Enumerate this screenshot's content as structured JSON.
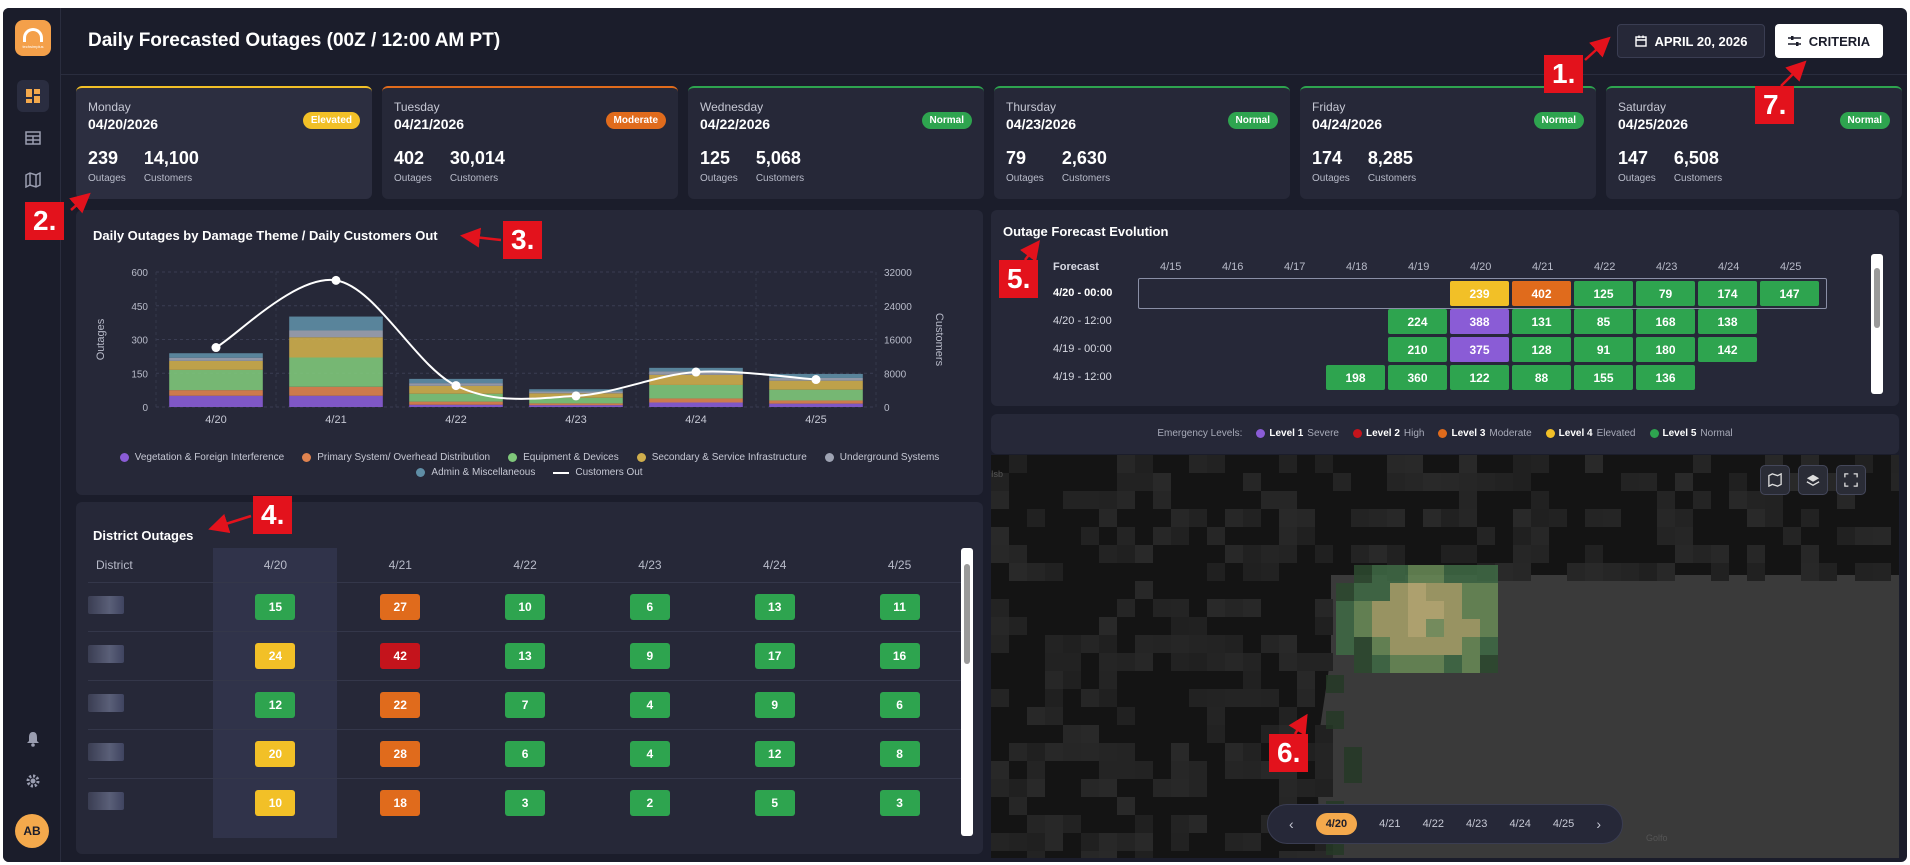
{
  "header": {
    "title": "Daily Forecasted Outages (00Z / 12:00 AM PT)",
    "date_label": "APRIL 20, 2026",
    "criteria_label": "CRITERIA"
  },
  "logo": {
    "text": "techsimplus"
  },
  "user": {
    "initials": "AB"
  },
  "days": [
    {
      "name": "Monday",
      "date": "04/20/2026",
      "status": "Elevated",
      "color": "#f2c027",
      "outages": "239",
      "customers": "14,100"
    },
    {
      "name": "Tuesday",
      "date": "04/21/2026",
      "status": "Moderate",
      "color": "#e06b1c",
      "outages": "402",
      "customers": "30,014"
    },
    {
      "name": "Wednesday",
      "date": "04/22/2026",
      "status": "Normal",
      "color": "#2ea44f",
      "outages": "125",
      "customers": "5,068"
    },
    {
      "name": "Thursday",
      "date": "04/23/2026",
      "status": "Normal",
      "color": "#2ea44f",
      "outages": "79",
      "customers": "2,630"
    },
    {
      "name": "Friday",
      "date": "04/24/2026",
      "status": "Normal",
      "color": "#2ea44f",
      "outages": "174",
      "customers": "8,285"
    },
    {
      "name": "Saturday",
      "date": "04/25/2026",
      "status": "Normal",
      "color": "#2ea44f",
      "outages": "147",
      "customers": "6,508"
    }
  ],
  "labels": {
    "outages": "Outages",
    "customers": "Customers"
  },
  "chart": {
    "title": "Daily Outages by Damage Theme / Daily Customers Out",
    "ylabel_left": "Outages",
    "ylabel_right": "Customers"
  },
  "chart_data": {
    "type": "bar",
    "stacked": true,
    "categories": [
      "4/20",
      "4/21",
      "4/22",
      "4/23",
      "4/24",
      "4/25"
    ],
    "ylim": [
      0,
      600
    ],
    "yticks": [
      0,
      150,
      300,
      450,
      600
    ],
    "y2lim": [
      0,
      32000
    ],
    "y2ticks": [
      0,
      8000,
      16000,
      24000,
      32000
    ],
    "series": [
      {
        "name": "Vegetation & Foreign Interference",
        "color": "#8a5cd6",
        "values": [
          50,
          50,
          10,
          8,
          20,
          15
        ]
      },
      {
        "name": "Primary System/ Overhead Distribution",
        "color": "#e0834f",
        "values": [
          25,
          40,
          14,
          8,
          18,
          14
        ]
      },
      {
        "name": "Equipment & Devices",
        "color": "#7fc77a",
        "values": [
          90,
          130,
          35,
          25,
          60,
          48
        ]
      },
      {
        "name": "Secondary & Service Infrastructure",
        "color": "#cfae4c",
        "values": [
          40,
          90,
          35,
          20,
          45,
          40
        ]
      },
      {
        "name": "Underground Systems",
        "color": "#9ea3b3",
        "values": [
          14,
          30,
          12,
          8,
          15,
          12
        ]
      },
      {
        "name": "Admin & Miscellaneous",
        "color": "#5f8ea6",
        "values": [
          20,
          62,
          19,
          10,
          16,
          18
        ]
      }
    ],
    "line": {
      "name": "Customers Out",
      "color": "#ffffff",
      "values": [
        14100,
        30014,
        5068,
        2630,
        8285,
        6508
      ]
    },
    "grid": true,
    "legend": "bottom"
  },
  "district": {
    "title": "District Outages",
    "col_district": "District",
    "dates": [
      "4/20",
      "4/21",
      "4/22",
      "4/23",
      "4/24",
      "4/25"
    ],
    "rows": [
      {
        "values": [
          "15",
          "27",
          "10",
          "6",
          "13",
          "11"
        ],
        "colors": [
          "c-green",
          "c-orange",
          "c-green",
          "c-green",
          "c-green",
          "c-green"
        ]
      },
      {
        "values": [
          "24",
          "42",
          "13",
          "9",
          "17",
          "16"
        ],
        "colors": [
          "c-yellow",
          "c-red",
          "c-green",
          "c-green",
          "c-green",
          "c-green"
        ]
      },
      {
        "values": [
          "12",
          "22",
          "7",
          "4",
          "9",
          "6"
        ],
        "colors": [
          "c-green",
          "c-orange",
          "c-green",
          "c-green",
          "c-green",
          "c-green"
        ]
      },
      {
        "values": [
          "20",
          "28",
          "6",
          "4",
          "12",
          "8"
        ],
        "colors": [
          "c-yellow",
          "c-orange",
          "c-green",
          "c-green",
          "c-green",
          "c-green"
        ]
      },
      {
        "values": [
          "10",
          "18",
          "3",
          "2",
          "5",
          "3"
        ],
        "colors": [
          "c-yellow",
          "c-orange",
          "c-green",
          "c-green",
          "c-green",
          "c-green"
        ]
      }
    ]
  },
  "evolution": {
    "title": "Outage Forecast Evolution",
    "col_forecast": "Forecast",
    "dates": [
      "4/15",
      "4/16",
      "4/17",
      "4/18",
      "4/19",
      "4/20",
      "4/21",
      "4/22",
      "4/23",
      "4/24",
      "4/25"
    ],
    "rows": [
      {
        "label": "4/20 - 00:00",
        "start": 5,
        "values": [
          "239",
          "402",
          "125",
          "79",
          "174",
          "147"
        ],
        "colors": [
          "#f2c027",
          "#e06b1c",
          "#2ea44f",
          "#2ea44f",
          "#2ea44f",
          "#2ea44f"
        ]
      },
      {
        "label": "4/20 - 12:00",
        "start": 4,
        "values": [
          "224",
          "388",
          "131",
          "85",
          "168",
          "138"
        ],
        "colors": [
          "#2ea44f",
          "#8a5cd6",
          "#2ea44f",
          "#2ea44f",
          "#2ea44f",
          "#2ea44f"
        ]
      },
      {
        "label": "4/19 - 00:00",
        "start": 4,
        "values": [
          "210",
          "375",
          "128",
          "91",
          "180",
          "142"
        ],
        "colors": [
          "#2ea44f",
          "#8a5cd6",
          "#2ea44f",
          "#2ea44f",
          "#2ea44f",
          "#2ea44f"
        ]
      },
      {
        "label": "4/19 - 12:00",
        "start": 3,
        "values": [
          "198",
          "360",
          "122",
          "88",
          "155",
          "136"
        ],
        "colors": [
          "#2ea44f",
          "#2ea44f",
          "#2ea44f",
          "#2ea44f",
          "#2ea44f",
          "#2ea44f"
        ]
      }
    ]
  },
  "emergency": {
    "label": "Emergency Levels:",
    "levels": [
      {
        "name": "Level 1",
        "desc": "Severe",
        "color": "#8a5cd6"
      },
      {
        "name": "Level 2",
        "desc": "High",
        "color": "#c4141c"
      },
      {
        "name": "Level 3",
        "desc": "Moderate",
        "color": "#e06b1c"
      },
      {
        "name": "Level 4",
        "desc": "Elevated",
        "color": "#f2c027"
      },
      {
        "name": "Level 5",
        "desc": "Normal",
        "color": "#2ea44f"
      }
    ]
  },
  "map": {
    "labels": [
      "Isb",
      "Golfo"
    ],
    "days": [
      "4/20",
      "4/21",
      "4/22",
      "4/23",
      "4/24",
      "4/25"
    ],
    "prev": "‹",
    "next": "›"
  },
  "markers": [
    "1.",
    "2.",
    "3.",
    "4.",
    "5.",
    "6.",
    "7."
  ]
}
